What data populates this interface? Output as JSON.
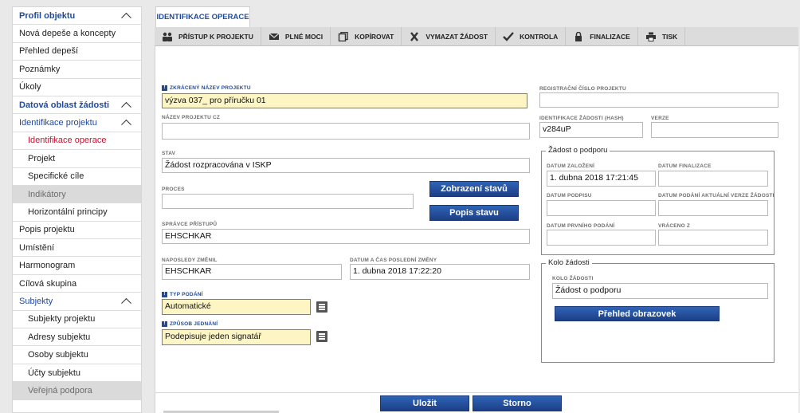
{
  "sidebar": {
    "items": [
      {
        "label": "Profil objektu",
        "kind": "section"
      },
      {
        "label": "Nová depeše a koncepty",
        "kind": "item"
      },
      {
        "label": "Přehled depeší",
        "kind": "item"
      },
      {
        "label": "Poznámky",
        "kind": "item"
      },
      {
        "label": "Úkoly",
        "kind": "item"
      },
      {
        "label": "Datová oblast žádosti",
        "kind": "section"
      },
      {
        "label": "Identifikace projektu",
        "kind": "group"
      },
      {
        "label": "Identifikace operace",
        "kind": "sub-active"
      },
      {
        "label": "Projekt",
        "kind": "sub"
      },
      {
        "label": "Specifické cíle",
        "kind": "sub"
      },
      {
        "label": "Indikátory",
        "kind": "sub-disabled"
      },
      {
        "label": "Horizontální principy",
        "kind": "sub"
      },
      {
        "label": "Popis projektu",
        "kind": "item"
      },
      {
        "label": "Umístění",
        "kind": "item"
      },
      {
        "label": "Harmonogram",
        "kind": "item"
      },
      {
        "label": "Cílová skupina",
        "kind": "item"
      },
      {
        "label": "Subjekty",
        "kind": "group"
      },
      {
        "label": "Subjekty projektu",
        "kind": "sub"
      },
      {
        "label": "Adresy subjektu",
        "kind": "sub"
      },
      {
        "label": "Osoby subjektu",
        "kind": "sub"
      },
      {
        "label": "Účty subjektu",
        "kind": "sub"
      },
      {
        "label": "Veřejná podpora",
        "kind": "sub-disabled"
      }
    ]
  },
  "tab": {
    "label": "IDENTIFIKACE OPERACE"
  },
  "toolbar": {
    "buttons": [
      {
        "label": "PŘÍSTUP K PROJEKTU",
        "icon": "people-icon"
      },
      {
        "label": "PLNÉ MOCI",
        "icon": "envelope-icon"
      },
      {
        "label": "KOPÍROVAT",
        "icon": "copy-icon"
      },
      {
        "label": "VYMAZAT ŽÁDOST",
        "icon": "x-icon"
      },
      {
        "label": "KONTROLA",
        "icon": "check-icon"
      },
      {
        "label": "FINALIZACE",
        "icon": "lock-icon"
      },
      {
        "label": "TISK",
        "icon": "printer-icon"
      }
    ]
  },
  "form": {
    "short_name_label": "ZKRÁCENÝ NÁZEV PROJEKTU",
    "short_name_value": "výzva 037_ pro příručku 01",
    "name_cz_label": "NÁZEV PROJEKTU CZ",
    "name_cz_value": "",
    "stav_label": "STAV",
    "stav_value": "Žádost rozpracována v ISKP",
    "proces_label": "PROCES",
    "proces_value": "",
    "btn_zobrazeni": "Zobrazení stavů",
    "btn_popis": "Popis stavu",
    "spravce_label": "SPRÁVCE PŘÍSTUPŮ",
    "spravce_value": "EHSCHKAR",
    "naposledy_label": "NAPOSLEDY ZMĚNIL",
    "naposledy_value": "EHSCHKAR",
    "datum_zmeny_label": "DATUM A ČAS POSLEDNÍ ZMĚNY",
    "datum_zmeny_value": "1. dubna 2018 17:22:20",
    "typ_label": "TYP PODÁNÍ",
    "typ_value": "Automatické",
    "zpusob_label": "ZPŮSOB JEDNÁNÍ",
    "zpusob_value": "Podepisuje jeden signatář",
    "reg_label": "REGISTRAČNÍ ČÍSLO PROJEKTU",
    "reg_value": "",
    "hash_label": "IDENTIFIKACE ŽÁDOSTI (HASH)",
    "hash_value": "v284uP",
    "verze_label": "VERZE",
    "verze_value": ""
  },
  "zadost": {
    "legend": "Žádost o podporu",
    "datum_zalozeni_label": "DATUM ZALOŽENÍ",
    "datum_zalozeni_value": "1. dubna 2018 17:21:45",
    "datum_finalizace_label": "DATUM FINALIZACE",
    "datum_finalizace_value": "",
    "datum_podpisu_label": "DATUM PODPISU",
    "datum_podpisu_value": "",
    "datum_podani_label": "DATUM PODÁNÍ AKTUÁLNÍ VERZE ŽÁDOSTI",
    "datum_podani_value": "",
    "datum_prvniho_label": "DATUM PRVNÍHO PODÁNÍ",
    "datum_prvniho_value": "",
    "vraceno_label": "VRÁCENO Z",
    "vraceno_value": ""
  },
  "kolo": {
    "legend": "Kolo žádosti",
    "label": "KOLO ŽÁDOSTI",
    "value": "Žádost o podporu",
    "btn": "Přehled obrazovek"
  },
  "footer": {
    "save": "Uložit",
    "cancel": "Storno"
  },
  "colors": {
    "accent": "#1f4a9c",
    "active_nav": "#c8102e",
    "required_bg": "#fdf6c4"
  }
}
